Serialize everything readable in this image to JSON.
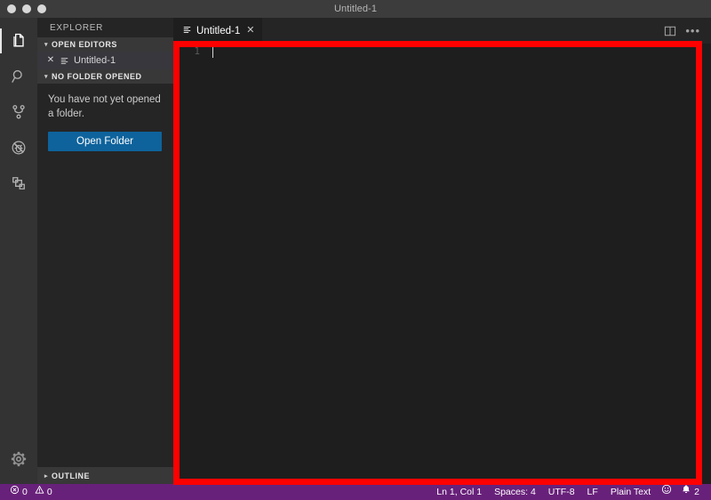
{
  "window": {
    "title": "Untitled-1",
    "traffic_lights": [
      "close-button",
      "minimize-button",
      "zoom-button"
    ]
  },
  "activity_bar": {
    "items": [
      {
        "name": "explorer",
        "icon": "files-icon",
        "title": "Explorer",
        "active": true
      },
      {
        "name": "search",
        "icon": "search-icon",
        "title": "Search",
        "active": false
      },
      {
        "name": "source-control",
        "icon": "source-control-icon",
        "title": "Source Control",
        "active": false
      },
      {
        "name": "debug",
        "icon": "debug-icon",
        "title": "Run and Debug",
        "active": false
      },
      {
        "name": "extensions",
        "icon": "extensions-icon",
        "title": "Extensions",
        "active": false
      }
    ],
    "bottom": [
      {
        "name": "manage",
        "icon": "gear-icon",
        "title": "Manage"
      }
    ]
  },
  "sidebar": {
    "title": "EXPLORER",
    "sections": {
      "open_editors": {
        "label": "OPEN EDITORS",
        "expanded": true,
        "twisty": "▾",
        "items": [
          {
            "label": "Untitled-1",
            "close": "✕",
            "icon": "file-text-icon"
          }
        ]
      },
      "no_folder": {
        "label": "NO FOLDER OPENED",
        "expanded": true,
        "twisty": "▾",
        "message": "You have not yet opened a folder.",
        "button_label": "Open Folder"
      },
      "outline": {
        "label": "OUTLINE",
        "expanded": false,
        "twisty": "▸"
      }
    }
  },
  "editor": {
    "tabs": [
      {
        "label": "Untitled-1",
        "icon": "file-text-icon",
        "close": "✕",
        "active": true
      }
    ],
    "actions": [
      {
        "name": "split-editor",
        "icon": "split-editor-icon"
      },
      {
        "name": "more-actions",
        "icon": "ellipsis-icon",
        "glyph": "•••"
      }
    ],
    "line_number": "1",
    "content": ""
  },
  "status_bar": {
    "background": "#68217a",
    "left": [
      {
        "name": "problems-errors",
        "icon": "error-icon",
        "text": "0"
      },
      {
        "name": "problems-warnings",
        "icon": "warning-icon",
        "text": "0"
      }
    ],
    "right": [
      {
        "name": "editor-position",
        "text": "Ln 1, Col 1"
      },
      {
        "name": "editor-indentation",
        "text": "Spaces: 4"
      },
      {
        "name": "editor-encoding",
        "text": "UTF-8"
      },
      {
        "name": "editor-eol",
        "text": "LF"
      },
      {
        "name": "editor-language",
        "text": "Plain Text"
      },
      {
        "name": "feedback",
        "icon": "smiley-icon",
        "text": ""
      },
      {
        "name": "notifications",
        "icon": "bell-icon",
        "text": "2"
      }
    ]
  },
  "annotation": {
    "highlight_color": "#ff0000",
    "target": "editor-area"
  }
}
